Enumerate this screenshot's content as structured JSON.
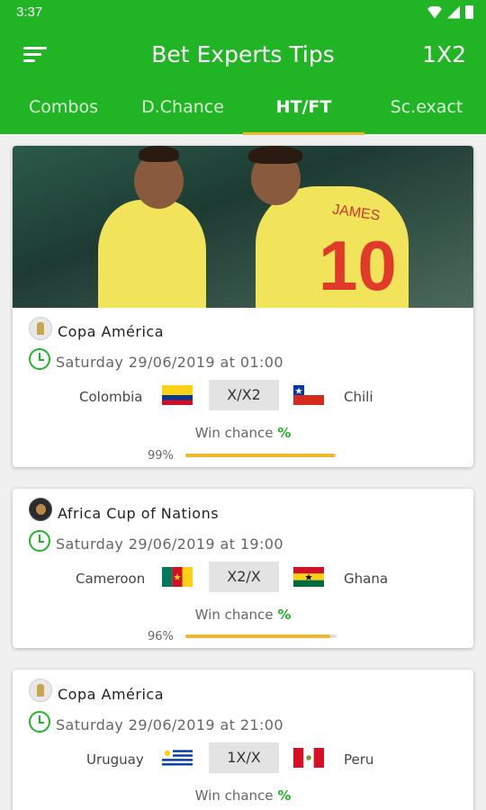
{
  "status": {
    "time": "3:37"
  },
  "appbar": {
    "title": "Bet Experts Tips",
    "action": "1X2"
  },
  "tabs": [
    {
      "label": "Combos",
      "active": false
    },
    {
      "label": "D.Chance",
      "active": false
    },
    {
      "label": "HT/FT",
      "active": true
    },
    {
      "label": "Sc.exact",
      "active": false
    }
  ],
  "matches": [
    {
      "league": "Copa América",
      "datetime": "Saturday 29/06/2019 at 01:00",
      "home": {
        "name": "Colombia",
        "flag": "colombia-flag"
      },
      "pick": "X/X2",
      "away": {
        "name": "Chili",
        "flag": "chile-flag"
      },
      "win_chance_label": "Win chance",
      "win_chance_symbol": "%",
      "progress_label": "99%",
      "progress": 0.99
    },
    {
      "league": "Africa Cup of Nations",
      "datetime": "Saturday 29/06/2019 at 19:00",
      "home": {
        "name": "Cameroon",
        "flag": "cameroon-flag"
      },
      "pick": "X2/X",
      "away": {
        "name": "Ghana",
        "flag": "ghana-flag"
      },
      "win_chance_label": "Win chance",
      "win_chance_symbol": "%",
      "progress_label": "96%",
      "progress": 0.96
    },
    {
      "league": "Copa América",
      "datetime": "Saturday 29/06/2019  at 21:00",
      "home": {
        "name": "Uruguay",
        "flag": "uruguay-flag"
      },
      "pick": "1X/X",
      "away": {
        "name": "Peru",
        "flag": "peru-flag"
      },
      "win_chance_label": "Win chance",
      "win_chance_symbol": "%"
    }
  ],
  "photo": {
    "jersey_name": "JAMES",
    "jersey_number": "10"
  },
  "colors": {
    "primary": "#21b526",
    "accent": "#f4b62a",
    "card": "#ffffff",
    "background": "#f0f0f0"
  }
}
